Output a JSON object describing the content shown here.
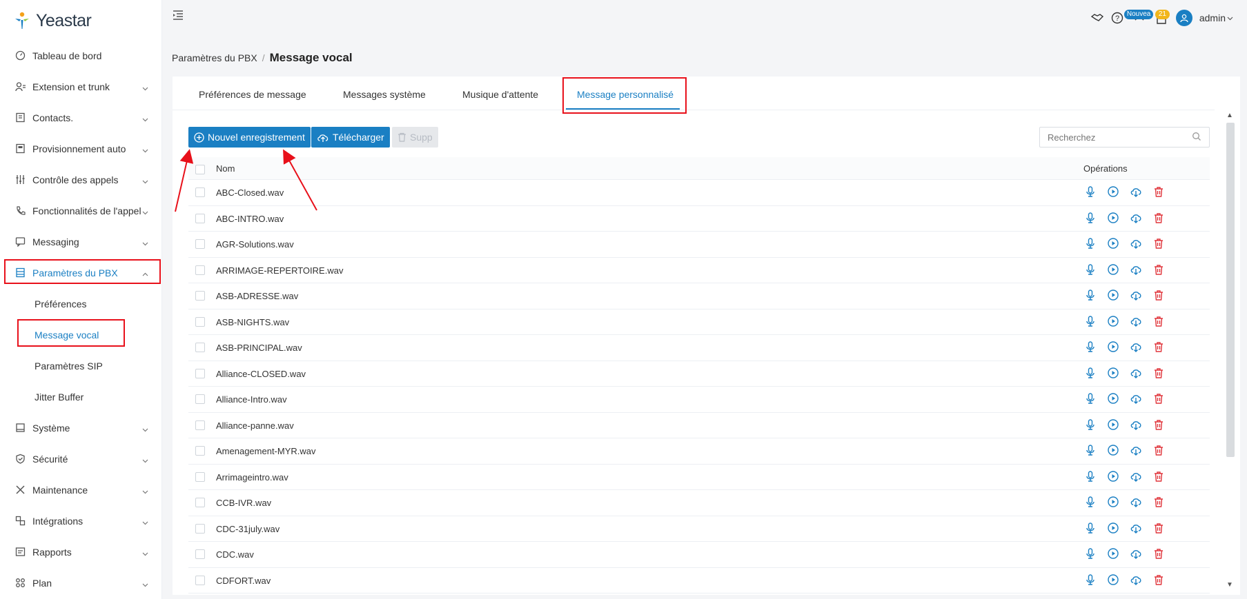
{
  "app": {
    "brand": "Yeastar"
  },
  "sidebar": {
    "items": [
      {
        "label": "Tableau de bord",
        "icon": "dashboard-icon",
        "chevron": false
      },
      {
        "label": "Extension et trunk",
        "icon": "user-list-icon",
        "chevron": true
      },
      {
        "label": "Contacts.",
        "icon": "contacts-book-icon",
        "chevron": true
      },
      {
        "label": "Provisionnement auto",
        "icon": "provisioning-icon",
        "chevron": true
      },
      {
        "label": "Contrôle des appels",
        "icon": "sliders-icon",
        "chevron": true
      },
      {
        "label": "Fonctionnalités de l'appel",
        "icon": "phone-feature-icon",
        "chevron": true
      },
      {
        "label": "Messaging",
        "icon": "message-icon",
        "chevron": true
      },
      {
        "label": "Paramètres du PBX",
        "icon": "pbx-settings-icon",
        "chevron": true,
        "expanded": true
      }
    ],
    "subitems": [
      {
        "label": "Préférences"
      },
      {
        "label": "Message vocal",
        "active": true
      },
      {
        "label": "Paramètres SIP"
      },
      {
        "label": "Jitter Buffer"
      }
    ],
    "items_after": [
      {
        "label": "Système",
        "icon": "system-icon"
      },
      {
        "label": "Sécurité",
        "icon": "shield-icon"
      },
      {
        "label": "Maintenance",
        "icon": "tools-icon"
      },
      {
        "label": "Intégrations",
        "icon": "integrations-icon"
      },
      {
        "label": "Rapports",
        "icon": "reports-icon"
      },
      {
        "label": "Plan",
        "icon": "plan-icon"
      }
    ]
  },
  "header": {
    "badge_new": "Nouvea",
    "badge_count": "21",
    "user": "admin"
  },
  "breadcrumb": {
    "parent": "Paramètres du PBX",
    "separator": "/",
    "current": "Message vocal"
  },
  "tabs": [
    {
      "label": "Préférences de message"
    },
    {
      "label": "Messages système"
    },
    {
      "label": "Musique d'attente"
    },
    {
      "label": "Message personnalisé",
      "active": true
    }
  ],
  "toolbar": {
    "new_label": "Nouvel enregistrement",
    "upload_label": "Télécharger",
    "delete_label": "Supp",
    "search_placeholder": "Recherchez"
  },
  "table": {
    "columns": {
      "name": "Nom",
      "ops": "Opérations"
    },
    "rows": [
      "ABC-Closed.wav",
      "ABC-INTRO.wav",
      "AGR-Solutions.wav",
      "ARRIMAGE-REPERTOIRE.wav",
      "ASB-ADRESSE.wav",
      "ASB-NIGHTS.wav",
      "ASB-PRINCIPAL.wav",
      "Alliance-CLOSED.wav",
      "Alliance-Intro.wav",
      "Alliance-panne.wav",
      "Amenagement-MYR.wav",
      "Arrimageintro.wav",
      "CCB-IVR.wav",
      "CDC-31july.wav",
      "CDC.wav",
      "CDFORT.wav"
    ],
    "op_icons": [
      "microphone-icon",
      "play-icon",
      "download-icon",
      "delete-icon"
    ]
  },
  "colors": {
    "accent": "#1a7fc3",
    "highlight": "#e8101a",
    "delete": "#e0353b",
    "badge": "#f2b61b"
  }
}
